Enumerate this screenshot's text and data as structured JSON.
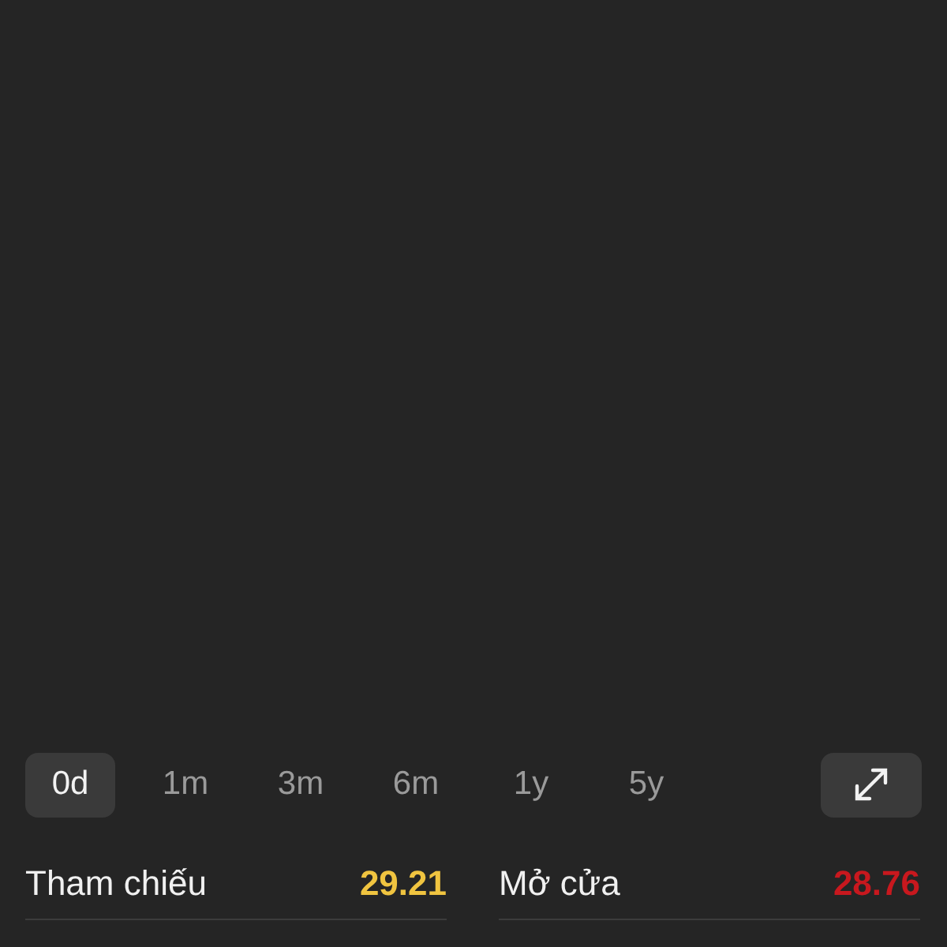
{
  "periods": [
    {
      "label": "0d",
      "selected": true
    },
    {
      "label": "1m",
      "selected": false
    },
    {
      "label": "3m",
      "selected": false
    },
    {
      "label": "6m",
      "selected": false
    },
    {
      "label": "1y",
      "selected": false
    },
    {
      "label": "5y",
      "selected": false
    }
  ],
  "stats": [
    {
      "label": "Tham chiếu",
      "value": "29.21",
      "color": "#f0c440"
    },
    {
      "label": "Mở cửa",
      "value": "28.76",
      "color": "#c8181e"
    }
  ]
}
